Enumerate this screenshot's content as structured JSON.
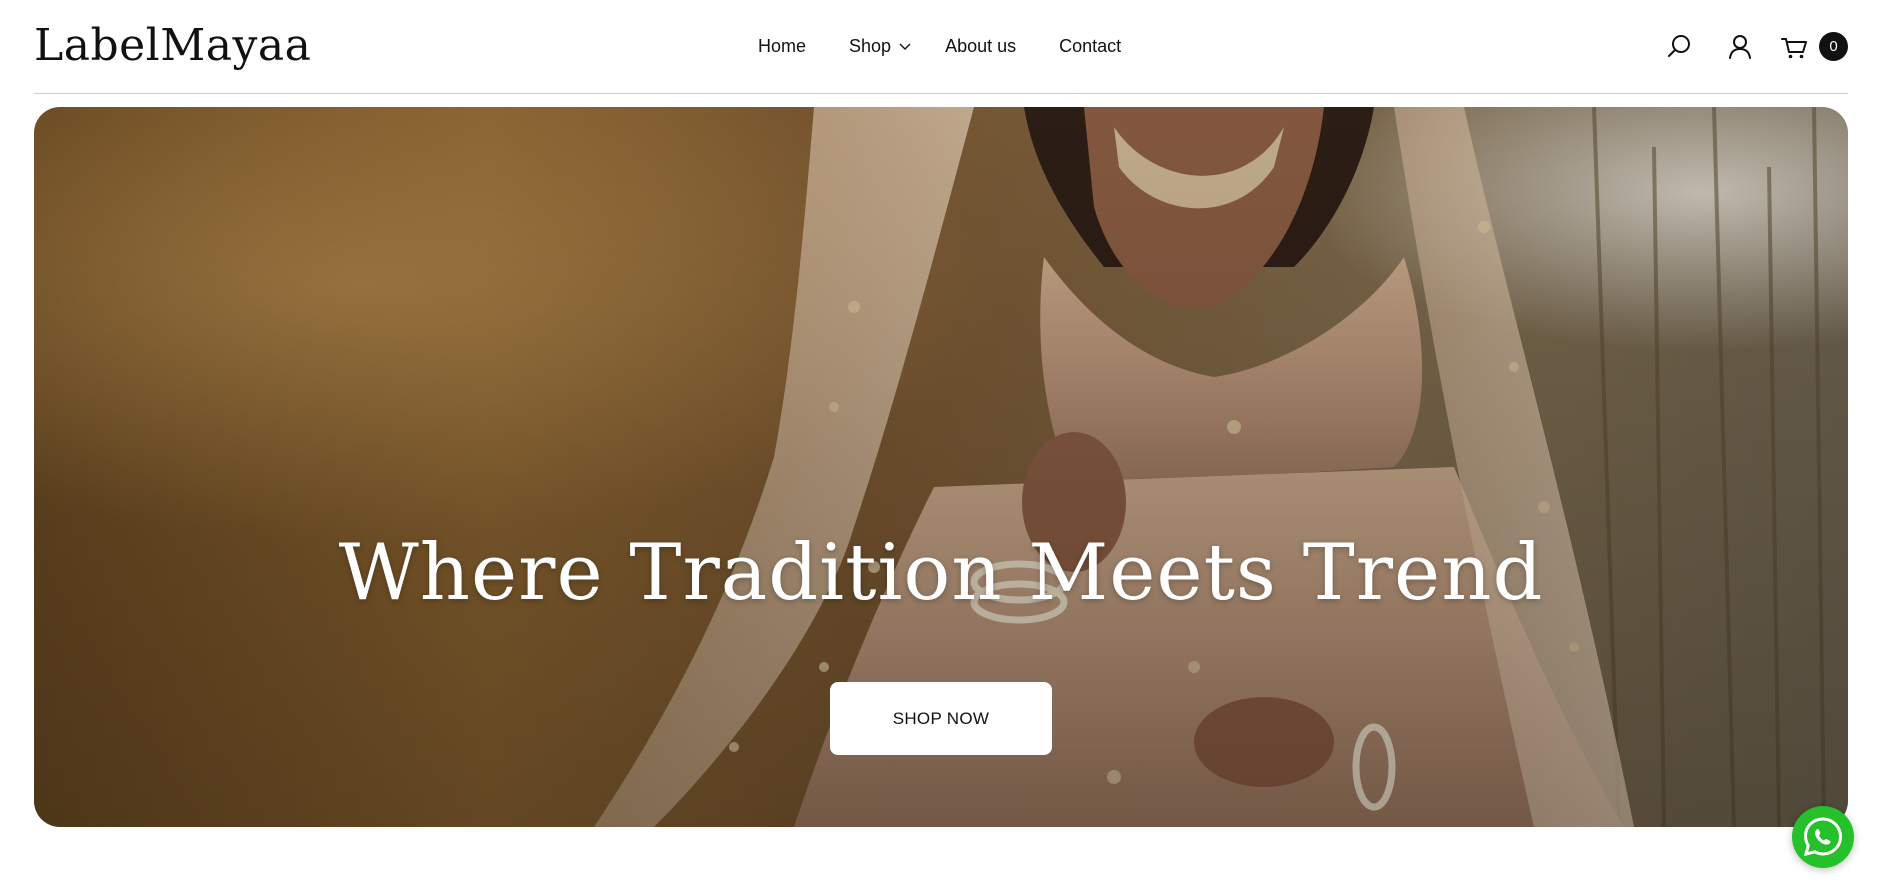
{
  "brand": {
    "name": "LabelMayaa"
  },
  "nav": {
    "items": [
      {
        "label": "Home"
      },
      {
        "label": "Shop"
      },
      {
        "label": "About us"
      },
      {
        "label": "Contact"
      }
    ]
  },
  "header_icons": {
    "search": "search-icon",
    "account": "user-icon",
    "cart": "cart-icon",
    "cart_count": "0"
  },
  "hero": {
    "title": "Where Tradition Meets Trend",
    "button_label": "SHOP NOW"
  },
  "floating": {
    "whatsapp": "whatsapp-icon",
    "whatsapp_color": "#25c02a"
  },
  "colors": {
    "text": "#111111",
    "background": "#ffffff",
    "divider": "#cfcfcf"
  }
}
